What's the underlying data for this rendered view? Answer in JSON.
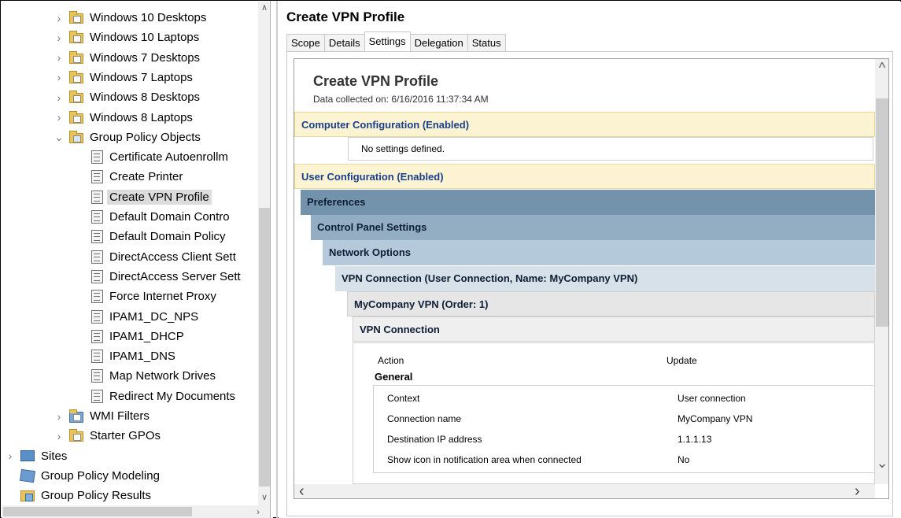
{
  "tree": {
    "items": [
      {
        "label": "Windows 10 Desktops",
        "icon": "folder-icon",
        "chevron": "›",
        "selected": false
      },
      {
        "label": "Windows 10 Laptops",
        "icon": "folder-icon",
        "chevron": "›",
        "selected": false
      },
      {
        "label": "Windows 7 Desktops",
        "icon": "folder-icon",
        "chevron": "›",
        "selected": false
      },
      {
        "label": "Windows 7 Laptops",
        "icon": "folder-icon",
        "chevron": "›",
        "selected": false
      },
      {
        "label": "Windows 8 Desktops",
        "icon": "folder-icon",
        "chevron": "›",
        "selected": false
      },
      {
        "label": "Windows 8 Laptops",
        "icon": "folder-icon",
        "chevron": "›",
        "selected": false
      },
      {
        "label": "Group Policy Objects",
        "icon": "gpo-folder-icon",
        "chevron": "⌄",
        "selected": false
      },
      {
        "label": "Certificate Autoenrollm",
        "icon": "gpo-icon",
        "chevron": "",
        "selected": false
      },
      {
        "label": "Create Printer",
        "icon": "gpo-icon",
        "chevron": "",
        "selected": false
      },
      {
        "label": "Create VPN Profile",
        "icon": "gpo-icon",
        "chevron": "",
        "selected": true
      },
      {
        "label": "Default Domain Contro",
        "icon": "gpo-icon",
        "chevron": "",
        "selected": false
      },
      {
        "label": "Default Domain Policy",
        "icon": "gpo-icon",
        "chevron": "",
        "selected": false
      },
      {
        "label": "DirectAccess Client Sett",
        "icon": "gpo-icon",
        "chevron": "",
        "selected": false
      },
      {
        "label": "DirectAccess Server Sett",
        "icon": "gpo-icon",
        "chevron": "",
        "selected": false
      },
      {
        "label": "Force Internet Proxy",
        "icon": "gpo-icon",
        "chevron": "",
        "selected": false
      },
      {
        "label": "IPAM1_DC_NPS",
        "icon": "gpo-icon",
        "chevron": "",
        "selected": false
      },
      {
        "label": "IPAM1_DHCP",
        "icon": "gpo-icon",
        "chevron": "",
        "selected": false
      },
      {
        "label": "IPAM1_DNS",
        "icon": "gpo-icon",
        "chevron": "",
        "selected": false
      },
      {
        "label": "Map Network Drives",
        "icon": "gpo-icon",
        "chevron": "",
        "selected": false
      },
      {
        "label": "Redirect My Documents",
        "icon": "gpo-icon",
        "chevron": "",
        "selected": false
      },
      {
        "label": "WMI Filters",
        "icon": "wmi-filters-icon",
        "chevron": "›",
        "selected": false
      },
      {
        "label": "Starter GPOs",
        "icon": "starter-gpos-icon",
        "chevron": "›",
        "selected": false
      },
      {
        "label": "Sites",
        "icon": "sites-icon",
        "chevron": "›",
        "selected": false
      },
      {
        "label": "Group Policy Modeling",
        "icon": "modeling-icon",
        "chevron": "",
        "selected": false
      },
      {
        "label": "Group Policy Results",
        "icon": "results-icon",
        "chevron": "",
        "selected": false
      }
    ]
  },
  "right": {
    "title": "Create VPN Profile",
    "tabs": [
      {
        "label": "Scope",
        "active": false
      },
      {
        "label": "Details",
        "active": false
      },
      {
        "label": "Settings",
        "active": true
      },
      {
        "label": "Delegation",
        "active": false
      },
      {
        "label": "Status",
        "active": false
      }
    ]
  },
  "report": {
    "title": "Create VPN Profile",
    "collected": "Data collected on: 6/16/2016 11:37:34 AM",
    "computer_config": "Computer Configuration (Enabled)",
    "no_settings": "No settings defined.",
    "user_config": "User Configuration (Enabled)",
    "preferences": "Preferences",
    "control_panel": "Control Panel Settings",
    "network_options": "Network Options",
    "vpn_connection_header": "VPN Connection (User Connection, Name: MyCompany VPN)",
    "mycompany_vpn": "MyCompany VPN (Order: 1)",
    "vpn_connection": "VPN Connection",
    "action_label": "Action",
    "action_value": "Update",
    "general": "General",
    "settings": [
      {
        "name": "Context",
        "value": "User connection"
      },
      {
        "name": "Connection name",
        "value": "MyCompany VPN"
      },
      {
        "name": "Destination IP address",
        "value": "1.1.1.13"
      },
      {
        "name": "Show icon in notification area when connected",
        "value": "No"
      }
    ]
  },
  "colors": {
    "config_band": "#fcf3d2",
    "config_text": "#1a3f8a",
    "preferences_band": "#7393ad"
  }
}
